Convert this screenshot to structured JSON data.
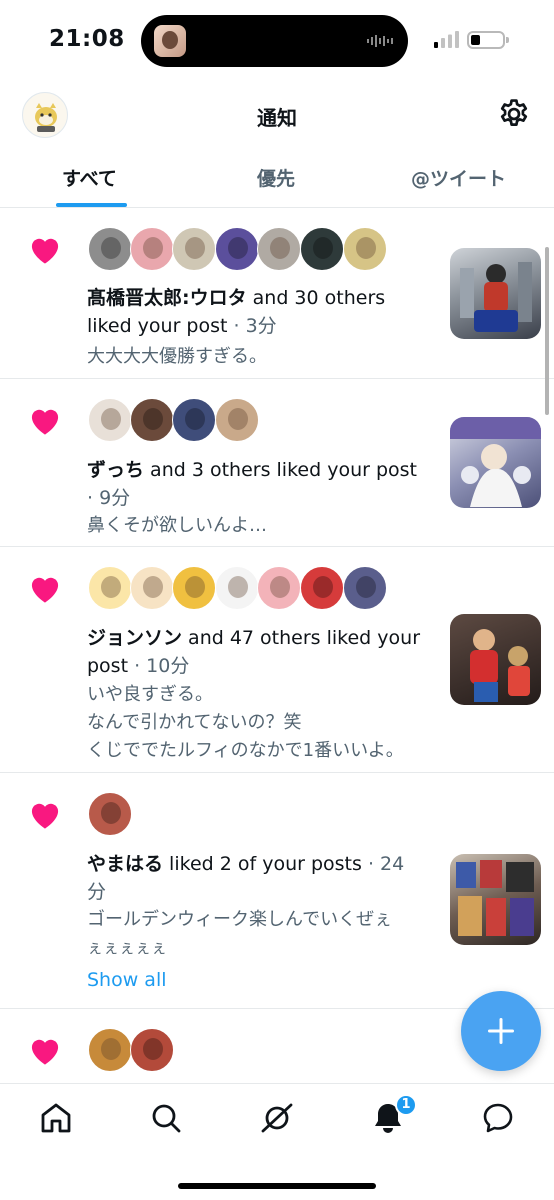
{
  "status_bar": {
    "time": "21:08"
  },
  "header": {
    "title": "通知"
  },
  "tabs": [
    {
      "label": "すべて",
      "active": true
    },
    {
      "label": "優先",
      "active": false
    },
    {
      "label": "@ツイート",
      "active": false
    }
  ],
  "notifications": [
    {
      "name": "髙橋晋太郎:ウロタ",
      "action": " and 30 others liked your post",
      "time": " · 3分",
      "snippet": "大大大大優勝すぎる。",
      "avatar_colors": [
        "#8d8d8d",
        "#e9a7ad",
        "#cfc7b4",
        "#5b4f9c",
        "#b0aaa3",
        "#2e3a3a",
        "#d6c486"
      ]
    },
    {
      "name": "ずっち",
      "action": " and 3 others liked your post",
      "time": "· 9分",
      "snippet": "鼻くそが欲しいんよ…",
      "avatar_colors": [
        "#e8e0d8",
        "#6b4a3b",
        "#3f4d7a",
        "#c9a98a"
      ]
    },
    {
      "name": "ジョンソン",
      "action": " and 47 others liked your",
      "action_2": "post",
      "time": " · 10分",
      "snippet_lines": [
        "いや良すぎる。",
        "なんで引かれてないの？笑",
        "くじででたルフィのなかで1番いいよ。"
      ],
      "avatar_colors": [
        "#fbe6a8",
        "#f7e3c4",
        "#f0c040",
        "#f4f4f4",
        "#f3b3b9",
        "#d63b3b",
        "#5a5e8c"
      ]
    },
    {
      "name": "やまはる",
      "action": " liked 2 of your posts",
      "time": " · 24",
      "time_2": "分",
      "snippet_lines": [
        "ゴールデンウィーク楽しんでいくぜぇ",
        "ぇぇぇぇぇ"
      ],
      "show_all": "Show all",
      "avatar_colors": [
        "#b85a4a"
      ]
    },
    {
      "avatar_colors": [
        "#c78a3a",
        "#b34a3a"
      ]
    }
  ],
  "nav": {
    "notification_badge": "1"
  },
  "colors": {
    "accent": "#1d9bf0",
    "heart": "#f91880",
    "fab": "#4aa3f2"
  },
  "icons": [
    "home-icon",
    "search-icon",
    "spaces-icon",
    "bell-icon",
    "messages-icon",
    "gear-icon",
    "heart-icon",
    "plus-icon"
  ]
}
